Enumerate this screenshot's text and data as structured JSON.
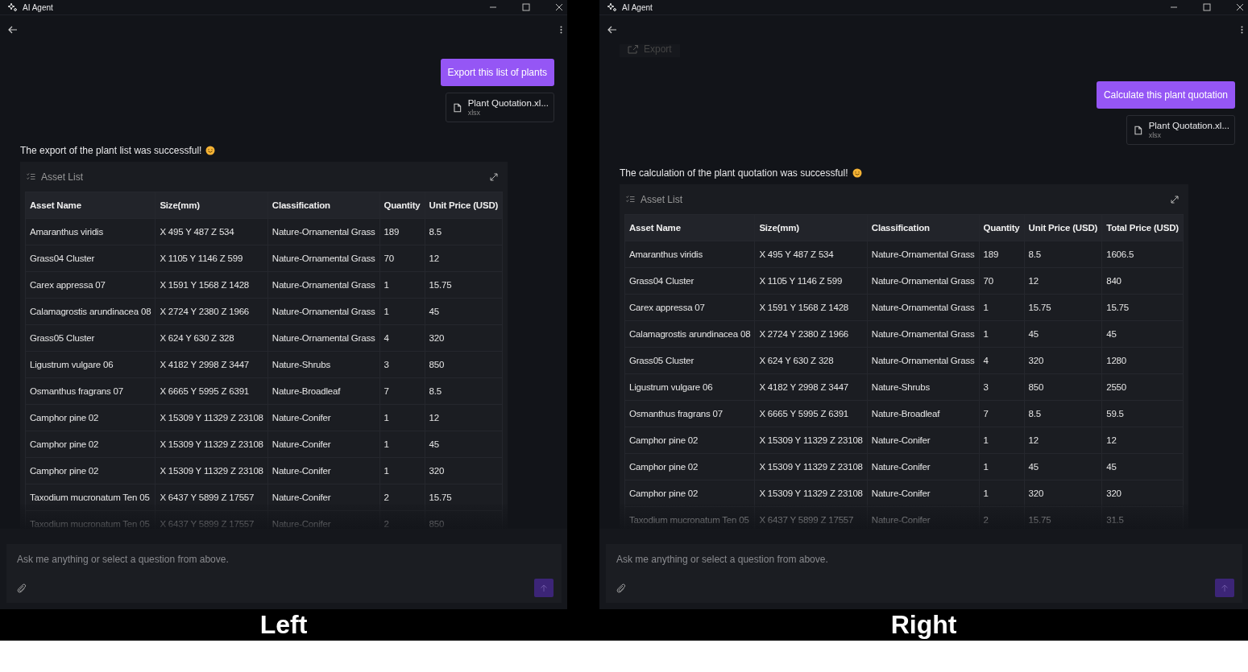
{
  "panels": [
    {
      "caption": "Left",
      "window": {
        "title": "AI Agent"
      },
      "chat": {
        "request": "Export this list of plants",
        "attachment": {
          "name": "Plant Quotation.xl...",
          "type": "xlsx"
        },
        "reply": "The export of the plant list was successful!",
        "card": {
          "title": "Asset List",
          "columns": [
            "Asset Name",
            "Size(mm)",
            "Classification",
            "Quantity",
            "Unit Price (USD)"
          ],
          "rows": [
            [
              "Amaranthus viridis",
              "X 495 Y 487 Z 534",
              "Nature-Ornamental Grass",
              "189",
              "8.5"
            ],
            [
              "Grass04 Cluster",
              "X 1105 Y 1146 Z 599",
              "Nature-Ornamental Grass",
              "70",
              "12"
            ],
            [
              "Carex appressa 07",
              "X 1591 Y 1568 Z 1428",
              "Nature-Ornamental Grass",
              "1",
              "15.75"
            ],
            [
              "Calamagrostis arundinacea 08",
              "X 2724 Y 2380 Z 1966",
              "Nature-Ornamental Grass",
              "1",
              "45"
            ],
            [
              "Grass05 Cluster",
              "X 624 Y 630 Z 328",
              "Nature-Ornamental Grass",
              "4",
              "320"
            ],
            [
              "Ligustrum vulgare 06",
              "X 4182 Y 2998 Z 3447",
              "Nature-Shrubs",
              "3",
              "850"
            ],
            [
              "Osmanthus fragrans 07",
              "X 6665 Y 5995 Z 6391",
              "Nature-Broadleaf",
              "7",
              "8.5"
            ],
            [
              "Camphor pine 02",
              "X 15309 Y 11329 Z 23108",
              "Nature-Conifer",
              "1",
              "12"
            ],
            [
              "Camphor pine 02",
              "X 15309 Y 11329 Z 23108",
              "Nature-Conifer",
              "1",
              "45"
            ],
            [
              "Camphor pine 02",
              "X 15309 Y 11329 Z 23108",
              "Nature-Conifer",
              "1",
              "320"
            ],
            [
              "Taxodium mucronatum Ten 05",
              "X 6437 Y 5899 Z 17557",
              "Nature-Conifer",
              "2",
              "15.75"
            ],
            [
              "Taxodium mucronatum Ten 05",
              "X 6437 Y 5899 Z 17557",
              "Nature-Conifer",
              "2",
              "850"
            ]
          ]
        }
      },
      "input": {
        "placeholder": "Ask me anything or select a question from above.",
        "send_disabled": true
      }
    },
    {
      "caption": "Right",
      "window": {
        "title": "AI Agent"
      },
      "chat": {
        "top_button": "Export",
        "request": "Calculate this plant quotation",
        "attachment": {
          "name": "Plant Quotation.xl...",
          "type": "xlsx"
        },
        "reply": "The calculation of the plant quotation was successful!",
        "card": {
          "title": "Asset List",
          "columns": [
            "Asset Name",
            "Size(mm)",
            "Classification",
            "Quantity",
            "Unit Price (USD)",
            "Total Price (USD)"
          ],
          "rows": [
            [
              "Amaranthus viridis",
              "X 495 Y 487 Z 534",
              "Nature-Ornamental Grass",
              "189",
              "8.5",
              "1606.5"
            ],
            [
              "Grass04 Cluster",
              "X 1105 Y 1146 Z 599",
              "Nature-Ornamental Grass",
              "70",
              "12",
              "840"
            ],
            [
              "Carex appressa 07",
              "X 1591 Y 1568 Z 1428",
              "Nature-Ornamental Grass",
              "1",
              "15.75",
              "15.75"
            ],
            [
              "Calamagrostis arundinacea 08",
              "X 2724 Y 2380 Z 1966",
              "Nature-Ornamental Grass",
              "1",
              "45",
              "45"
            ],
            [
              "Grass05 Cluster",
              "X 624 Y 630 Z 328",
              "Nature-Ornamental Grass",
              "4",
              "320",
              "1280"
            ],
            [
              "Ligustrum vulgare 06",
              "X 4182 Y 2998 Z 3447",
              "Nature-Shrubs",
              "3",
              "850",
              "2550"
            ],
            [
              "Osmanthus fragrans 07",
              "X 6665 Y 5995 Z 6391",
              "Nature-Broadleaf",
              "7",
              "8.5",
              "59.5"
            ],
            [
              "Camphor pine 02",
              "X 15309 Y 11329 Z 23108",
              "Nature-Conifer",
              "1",
              "12",
              "12"
            ],
            [
              "Camphor pine 02",
              "X 15309 Y 11329 Z 23108",
              "Nature-Conifer",
              "1",
              "45",
              "45"
            ],
            [
              "Camphor pine 02",
              "X 15309 Y 11329 Z 23108",
              "Nature-Conifer",
              "1",
              "320",
              "320"
            ],
            [
              "Taxodium mucronatum Ten 05",
              "X 6437 Y 5899 Z 17557",
              "Nature-Conifer",
              "2",
              "15.75",
              "31.5"
            ]
          ]
        }
      },
      "input": {
        "placeholder": "Ask me anything or select a question from above.",
        "send_disabled": true
      }
    }
  ]
}
